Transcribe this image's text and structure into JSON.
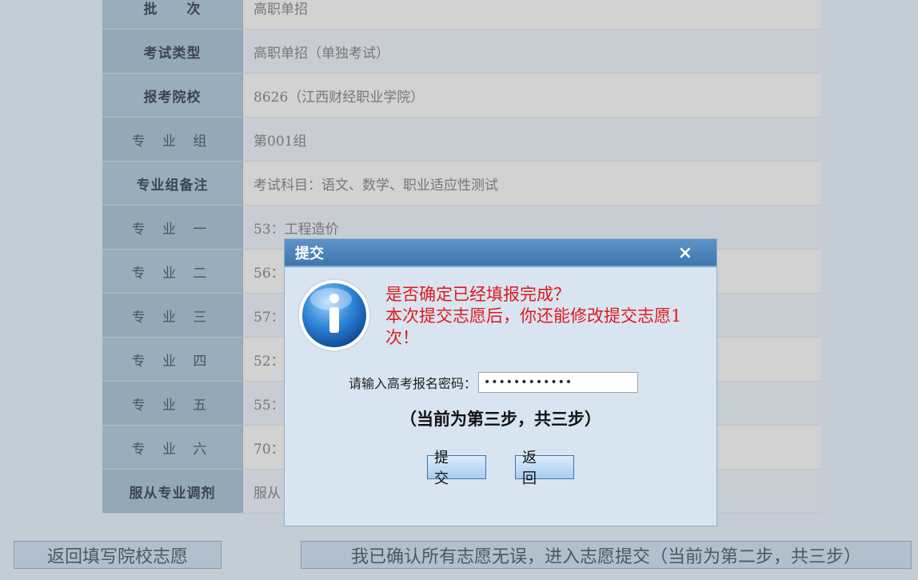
{
  "form": {
    "rows": [
      {
        "label": "批　　次",
        "value": "高职单招"
      },
      {
        "label": "考试类型",
        "value": "高职单招（单独考试）"
      },
      {
        "label": "报考院校",
        "value": "8626（江西财经职业学院）"
      },
      {
        "label": "专 业 组",
        "value": "第001组"
      },
      {
        "label": "专业组备注",
        "value": "考试科目：语文、数学、职业适应性测试"
      },
      {
        "label": "专 业 一",
        "value": "53：工程造价"
      },
      {
        "label": "专 业 二",
        "value": "56："
      },
      {
        "label": "专 业 三",
        "value": "57："
      },
      {
        "label": "专 业 四",
        "value": "52："
      },
      {
        "label": "专 业 五",
        "value": "55："
      },
      {
        "label": "专 业 六",
        "value": "70："
      },
      {
        "label": "服从专业调剂",
        "value": "服从"
      }
    ]
  },
  "bottom": {
    "back_label": "返回填写院校志愿",
    "confirm_label": "我已确认所有志愿无误，进入志愿提交（当前为第二步，共三步）"
  },
  "dialog": {
    "title": "提交",
    "close_icon": "×",
    "message_line1": "是否确定已经填报完成？",
    "message_line2": "本次提交志愿后，你还能修改提交志愿1次！",
    "password_label": "请输入高考报名密码：",
    "password_value": "••••••••••••",
    "step_text": "（当前为第三步，共三步）",
    "submit_label": "提 交",
    "return_label": "返 回"
  }
}
